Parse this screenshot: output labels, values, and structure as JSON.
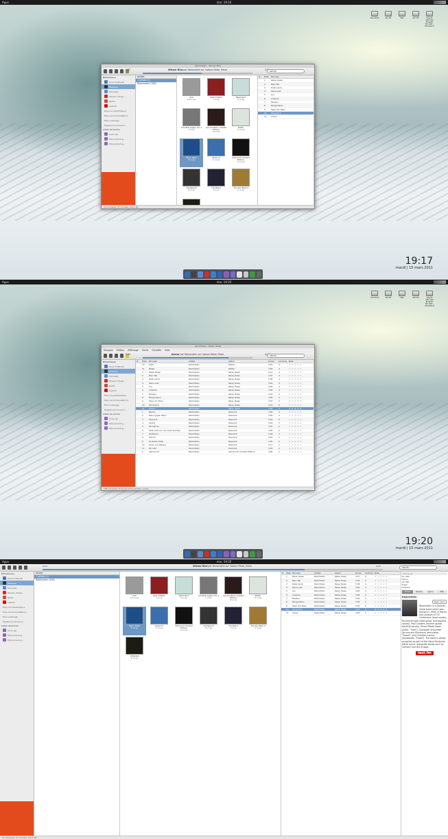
{
  "topbar": {
    "apps": "Apps",
    "time1": "mar. 19:16",
    "time2": "mar. 19:20",
    "time3": "mar. 19:20"
  },
  "desktop_icons": [
    "document",
    "abc 90",
    "Mes",
    "abc CD",
    "Cap de l'abri (Ipo Ernesto) Mh 7/W) - Windows 8"
  ],
  "clock1": {
    "time": "19:17",
    "date": "mardi | 15 mars 2011"
  },
  "clock2": {
    "time": "19:20",
    "date": "mardi | 15 mars 2011"
  },
  "window1": {
    "title": "Rammstein - Wiener Blut",
    "menu": []
  },
  "window2": {
    "title": "Rammstein - Reise, Reise",
    "menu": [
      "Musique",
      "Édition",
      "Affichage",
      "Outils",
      "Contrôle",
      "Aide"
    ]
  },
  "nowplaying": {
    "track1": "Wiener Blut",
    "artist1": "Rammstein",
    "album1": "Reise, Reise",
    "pre1": "par",
    "mid1": "sur l'album",
    "track2": "Amour",
    "search": "ramm",
    "elapsed1": "1:57",
    "total1": "3:35",
    "elapsed2": "3:44",
    "total2": "4:47",
    "elapsed3": "4:10",
    "total3": "5:22"
  },
  "sidebar": {
    "library": "Bibliothèque",
    "playlists": "Listes de lecture",
    "items": [
      "Sons d'attente",
      "Musique",
      "Podcasts",
      "Stream d'Inpp...",
      "Radio",
      "Last.fm",
      "Files ma bibliothèque",
      "Files recommandations",
      "Files voisinage",
      "Mysterious Group fr...",
      "Sons rap",
      "Mouvement g...",
      "Mouvement g..."
    ]
  },
  "artists": {
    "header": "Artiste",
    "all": "1 artiste (1)",
    "list": [
      "Rammstein (106)"
    ]
  },
  "albums": [
    {
      "name": "Tout",
      "count": "106 songs",
      "color": "#9a9a9a"
    },
    {
      "name": "Best of Metal",
      "count": "7 songs",
      "color": "#8b1e1e"
    },
    {
      "name": "Benzinbrot",
      "count": "11 songs",
      "color": "#c7ddd8"
    },
    {
      "name": "Industrial Legacy Vol. 2",
      "count": "2 songs",
      "color": "#777"
    },
    {
      "name": "Live aus Berlin (Limited Edition)",
      "count": "18 songs",
      "color": "#2a1a1a"
    },
    {
      "name": "Mutter",
      "count": "11 songs",
      "color": "#dde4dd"
    },
    {
      "name": "Reise, Reise",
      "count": "11 songs",
      "color": "#1d4e8a"
    },
    {
      "name": "Rosenrot",
      "count": "11 songs",
      "color": "#3b6fae"
    },
    {
      "name": "Sehnsucht (Limited Edition)",
      "count": "14 songs",
      "color": "#111"
    },
    {
      "name": "The Best Of",
      "count": "18 songs",
      "color": "#333"
    },
    {
      "name": "The Mahra",
      "count": "4 songs",
      "color": "#223"
    },
    {
      "name": "The Very Best of",
      "count": "11 songs",
      "color": "#a07a35"
    },
    {
      "name": "Völkerball",
      "count": "16 songs",
      "color": "#1c1c14"
    }
  ],
  "trackcols": [
    "#",
    "Piste",
    "Morceau",
    "Artiste",
    "Album",
    "Durée",
    "Lectures",
    "Note"
  ],
  "tracks_short": [
    {
      "n": "1",
      "t": "Reise, Reise"
    },
    {
      "n": "2",
      "t": "Mein Teil"
    },
    {
      "n": "3",
      "t": "Dalai Lama"
    },
    {
      "n": "4",
      "t": "Keine Lust"
    },
    {
      "n": "5",
      "t": "Los"
    },
    {
      "n": "6",
      "t": "Amerika"
    },
    {
      "n": "7",
      "t": "Moskau"
    },
    {
      "n": "8",
      "t": "Morgenstern"
    },
    {
      "n": "9",
      "t": "Stein Um Stein"
    },
    {
      "n": "10",
      "t": "Ohne Dich"
    },
    {
      "n": "11",
      "t": "Amour"
    }
  ],
  "tracks_long": [
    {
      "n": "10",
      "t": "Adios",
      "a": "Rammstein",
      "al": "Mutter",
      "d": "3:51",
      "p": "4"
    },
    {
      "n": "11",
      "t": "Nebel",
      "a": "Rammstein",
      "al": "Mutter",
      "d": "4:56",
      "p": "4"
    },
    {
      "n": "1",
      "t": "Reise, Reise",
      "a": "Rammstein",
      "al": "Reise, Reise",
      "d": "4:11",
      "p": "4"
    },
    {
      "n": "2",
      "t": "Mein Teil",
      "a": "Rammstein",
      "al": "Reise, Reise",
      "d": "4:32",
      "p": "4"
    },
    {
      "n": "3",
      "t": "Dalai Lama",
      "a": "Rammstein",
      "al": "Reise, Reise",
      "d": "5:38",
      "p": "4"
    },
    {
      "n": "4",
      "t": "Keine Lust",
      "a": "Rammstein",
      "al": "Reise, Reise",
      "d": "3:42",
      "p": "4"
    },
    {
      "n": "5",
      "t": "Los",
      "a": "Rammstein",
      "al": "Reise, Reise",
      "d": "4:20",
      "p": "4"
    },
    {
      "n": "6",
      "t": "Amerika",
      "a": "Rammstein",
      "al": "Reise, Reise",
      "d": "3:46",
      "p": "4"
    },
    {
      "n": "7",
      "t": "Moskau",
      "a": "Rammstein",
      "al": "Reise, Reise",
      "d": "4:16",
      "p": "4"
    },
    {
      "n": "8",
      "t": "Morgenstern",
      "a": "Rammstein",
      "al": "Reise, Reise",
      "d": "3:59",
      "p": "5"
    },
    {
      "n": "9",
      "t": "Stein Um Stein",
      "a": "Rammstein",
      "al": "Reise, Reise",
      "d": "3:54",
      "p": "5"
    },
    {
      "n": "10",
      "t": "Ohne Dich",
      "a": "Rammstein",
      "al": "Reise, Reise",
      "d": "4:31",
      "p": "5"
    },
    {
      "n": "11",
      "t": "Amour",
      "a": "Rammstein",
      "al": "Reise, Reise",
      "d": "4:50",
      "p": "5"
    },
    {
      "n": "1",
      "t": "Benzin",
      "a": "Rammstein",
      "al": "Rosenrot",
      "d": "3:46",
      "p": "4"
    },
    {
      "n": "2",
      "t": "Mann gegen Mann",
      "a": "Rammstein",
      "al": "Rosenrot",
      "d": "3:50",
      "p": "4"
    },
    {
      "n": "3",
      "t": "Rosenrot",
      "a": "Rammstein",
      "al": "Rosenrot",
      "d": "3:54",
      "p": "5"
    },
    {
      "n": "4",
      "t": "Spring",
      "a": "Rammstein",
      "al": "Rosenrot",
      "d": "5:24",
      "p": "5"
    },
    {
      "n": "5",
      "t": "Wo bist du",
      "a": "Rammstein",
      "al": "Rosenrot",
      "d": "3:55",
      "p": "2"
    },
    {
      "n": "6",
      "t": "Stirb nicht vor mir (feat. Sharlee...",
      "a": "Rammstein",
      "al": "Rosenrot",
      "d": "4:05",
      "p": "2"
    },
    {
      "n": "7",
      "t": "Zerstören",
      "a": "Rammstein",
      "al": "Rosenrot",
      "d": "5:28",
      "p": "2"
    },
    {
      "n": "8",
      "t": "Hilf mir",
      "a": "Rammstein",
      "al": "Rosenrot",
      "d": "4:43",
      "p": "2"
    },
    {
      "n": "9",
      "t": "Te Quiero Puta!",
      "a": "Rammstein",
      "al": "Rosenrot",
      "d": "3:35",
      "p": "2"
    },
    {
      "n": "10",
      "t": "Feuer und Wasser",
      "a": "Rammstein",
      "al": "Rosenrot",
      "d": "5:17",
      "p": "2"
    },
    {
      "n": "11",
      "t": "Ein Lied",
      "a": "Rammstein",
      "al": "Rosenrot",
      "d": "3:43",
      "p": "2"
    },
    {
      "n": "1",
      "t": "Sehnsucht",
      "a": "Rammstein",
      "al": "Sehnsucht (Limited Edition)",
      "d": "4:06",
      "p": "2"
    }
  ],
  "tracks_full": [
    {
      "n": "1",
      "t": "Reise, Reise",
      "a": "Rammstein",
      "al": "Reise, Reise",
      "d": "4:11",
      "p": "4"
    },
    {
      "n": "2",
      "t": "Mein Teil",
      "a": "Rammstein",
      "al": "Reise, Reise",
      "d": "4:32",
      "p": "4"
    },
    {
      "n": "3",
      "t": "Dalai Lama",
      "a": "Rammstein",
      "al": "Reise, Reise",
      "d": "5:38",
      "p": "4"
    },
    {
      "n": "4",
      "t": "Keine Lust",
      "a": "Rammstein",
      "al": "Reise, Reise",
      "d": "3:42",
      "p": "4"
    },
    {
      "n": "5",
      "t": "Los",
      "a": "Rammstein",
      "al": "Reise, Reise",
      "d": "4:20",
      "p": "4"
    },
    {
      "n": "6",
      "t": "Amerika",
      "a": "Rammstein",
      "al": "Reise, Reise",
      "d": "3:46",
      "p": "4"
    },
    {
      "n": "7",
      "t": "Moskau",
      "a": "Rammstein",
      "al": "Reise, Reise",
      "d": "4:16",
      "p": "4"
    },
    {
      "n": "8",
      "t": "Morgenstern",
      "a": "Rammstein",
      "al": "Reise, Reise",
      "d": "3:59",
      "p": "5"
    },
    {
      "n": "9",
      "t": "Stein Um Stein",
      "a": "Rammstein",
      "al": "Reise, Reise",
      "d": "3:54",
      "p": "5"
    },
    {
      "n": "10",
      "t": "Ohne Dich",
      "a": "Rammstein",
      "al": "Reise, Reise",
      "d": "4:31",
      "p": "5"
    },
    {
      "n": "11",
      "t": "Amour",
      "a": "Rammstein",
      "al": "Reise, Reise",
      "d": "4:50",
      "p": "5"
    }
  ],
  "stars": "★ ★ ★ ★ ★",
  "info": {
    "playing": [
      "Du hast",
      "Sonne",
      "Ich Will",
      "Engel",
      "Amerika"
    ],
    "tabs": [
      "Artiste",
      "Albums",
      "Lyrics",
      "Web"
    ],
    "artist": "Rammstein",
    "readmore": "Read more",
    "bio": "Rammstein is a German metal band which was formed in 1994, in Berlin, and consists of Till Lindemann (lead vocals), Richard Kruspe (lead guitar and backing vocals), Paul Landers (rhythm guitar, backing vocals), Oliver Riedel (bass guitar, \"Ollie\"), Christoph Schneider (drums and Electronic percussion, \"Doom\") and Christian Lorenz (keyboards, \"Flake\"). The band is widely accepted as part of the Neue Deutsche Härte scene, alongside bands such as Oomph! and Die Krupps.",
    "lastfm": "last.fm"
  },
  "status1": "11 morceaux, 47 minutes, 115,1 Mo",
  "status2": "106 morceaux, 8 heures et 42 minutes, 1,4 Go",
  "status3": "11 morceaux, 47 minutes, 115,1 Mo",
  "dock_colors": [
    "#2f6fb5",
    "#444",
    "#5a8bd0",
    "#d42a2a",
    "#3b7fd0",
    "#2d64b8",
    "#8c5fb7",
    "#7a6ad0",
    "#e6e6e6",
    "#c9c9c9",
    "#3d9b3d",
    "#666"
  ]
}
